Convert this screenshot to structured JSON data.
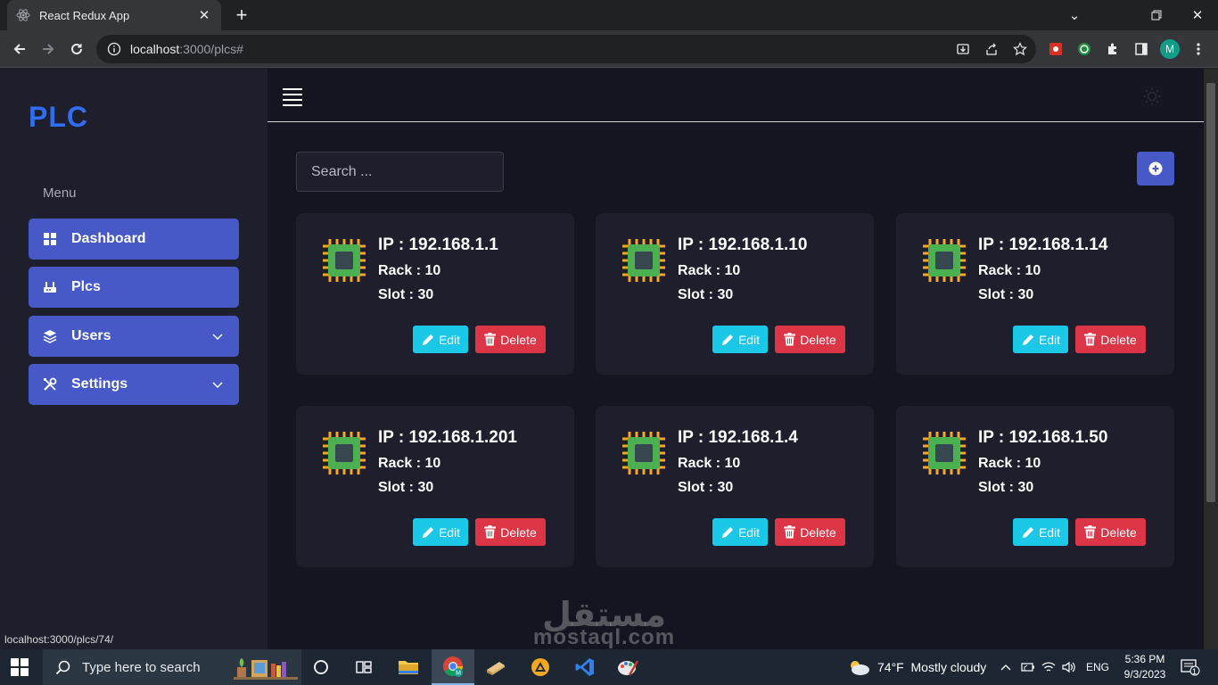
{
  "browser": {
    "tab_title": "React Redux App",
    "url_host": "localhost",
    "url_rest": ":3000/plcs#",
    "profile_initial": "M",
    "status_url": "localhost:3000/plcs/74/"
  },
  "sidebar": {
    "brand": "PLC",
    "menu_label": "Menu",
    "items": [
      {
        "label": "Dashboard",
        "icon": "grid-icon"
      },
      {
        "label": "Plcs",
        "icon": "plc-icon"
      },
      {
        "label": "Users",
        "icon": "layers-icon",
        "has_submenu": true
      },
      {
        "label": "Settings",
        "icon": "tools-icon",
        "has_submenu": true
      }
    ]
  },
  "main": {
    "search_placeholder": "Search ...",
    "cards": [
      {
        "ip": "IP : 192.168.1.1",
        "rack": "Rack : 10",
        "slot": "Slot : 30"
      },
      {
        "ip": "IP : 192.168.1.10",
        "rack": "Rack : 10",
        "slot": "Slot : 30"
      },
      {
        "ip": "IP : 192.168.1.14",
        "rack": "Rack : 10",
        "slot": "Slot : 30"
      },
      {
        "ip": "IP : 192.168.1.201",
        "rack": "Rack : 10",
        "slot": "Slot : 30"
      },
      {
        "ip": "IP : 192.168.1.4",
        "rack": "Rack : 10",
        "slot": "Slot : 30"
      },
      {
        "ip": "IP : 192.168.1.50",
        "rack": "Rack : 10",
        "slot": "Slot : 30"
      }
    ],
    "edit_label": "Edit",
    "delete_label": "Delete"
  },
  "watermark": {
    "arabic": "مستقل",
    "latin": "mostaql.com"
  },
  "taskbar": {
    "search_placeholder": "Type here to search",
    "weather": "74°F  Mostly cloudy",
    "language": "ENG",
    "time": "5:36 PM",
    "date": "9/3/2023",
    "notification_count": "1"
  },
  "colors": {
    "accent": "#4659c6",
    "brand": "#2f6ef0",
    "edit": "#1bc8e8",
    "delete": "#dc3545",
    "sidebar_bg": "#1e1e2d",
    "main_bg": "#151521"
  }
}
